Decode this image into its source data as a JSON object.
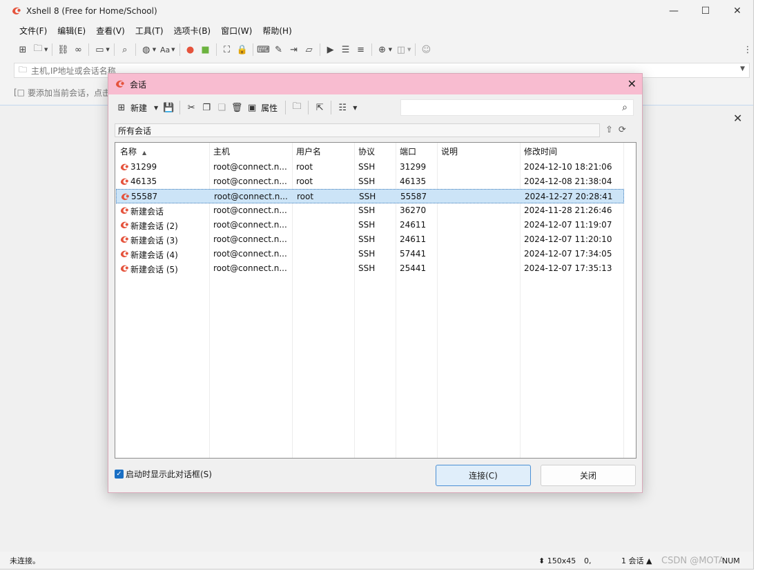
{
  "app": {
    "title": "Xshell 8 (Free for Home/School)",
    "brand_color": "#e5533c",
    "menu": [
      "文件(F)",
      "编辑(E)",
      "查看(V)",
      "工具(T)",
      "选项卡(B)",
      "窗口(W)",
      "帮助(H)"
    ],
    "address_placeholder": "主机,IP地址或会话名称",
    "hint_text": "要添加当前会话，点击",
    "status": {
      "connection": "未连接。",
      "size": "150x45",
      "position": "0,",
      "sessions": "1 会话",
      "num": "NUM"
    },
    "watermark": "CSDN @MOTA"
  },
  "dialog": {
    "title": "会话",
    "title_bg": "#f8bcd0",
    "toolbar": {
      "new_label": "新建",
      "properties_label": "属性"
    },
    "breadcrumb": "所有会话",
    "columns": [
      "名称",
      "主机",
      "用户名",
      "协议",
      "端口",
      "说明",
      "修改时间"
    ],
    "rows": [
      {
        "name": "31299",
        "host": "root@connect.n...",
        "user": "root",
        "protocol": "SSH",
        "port": "31299",
        "desc": "",
        "modified": "2024-12-10 18:21:06"
      },
      {
        "name": "46135",
        "host": "root@connect.n...",
        "user": "root",
        "protocol": "SSH",
        "port": "46135",
        "desc": "",
        "modified": "2024-12-08 21:38:04"
      },
      {
        "name": "55587",
        "host": "root@connect.n...",
        "user": "root",
        "protocol": "SSH",
        "port": "55587",
        "desc": "",
        "modified": "2024-12-27 20:28:41",
        "selected": true
      },
      {
        "name": "新建会话",
        "host": "root@connect.n...",
        "user": "",
        "protocol": "SSH",
        "port": "36270",
        "desc": "",
        "modified": "2024-11-28 21:26:46"
      },
      {
        "name": "新建会话 (2)",
        "host": "root@connect.n...",
        "user": "",
        "protocol": "SSH",
        "port": "24611",
        "desc": "",
        "modified": "2024-12-07 11:19:07"
      },
      {
        "name": "新建会话 (3)",
        "host": "root@connect.n...",
        "user": "",
        "protocol": "SSH",
        "port": "24611",
        "desc": "",
        "modified": "2024-12-07 11:20:10"
      },
      {
        "name": "新建会话 (4)",
        "host": "root@connect.n...",
        "user": "",
        "protocol": "SSH",
        "port": "57441",
        "desc": "",
        "modified": "2024-12-07 17:34:05"
      },
      {
        "name": "新建会话 (5)",
        "host": "root@connect.n...",
        "user": "",
        "protocol": "SSH",
        "port": "25441",
        "desc": "",
        "modified": "2024-12-07 17:35:13"
      }
    ],
    "startup_checkbox": {
      "label": "启动时显示此对话框(S)",
      "checked": true
    },
    "connect_button": "连接(C)",
    "close_button": "关闭"
  }
}
